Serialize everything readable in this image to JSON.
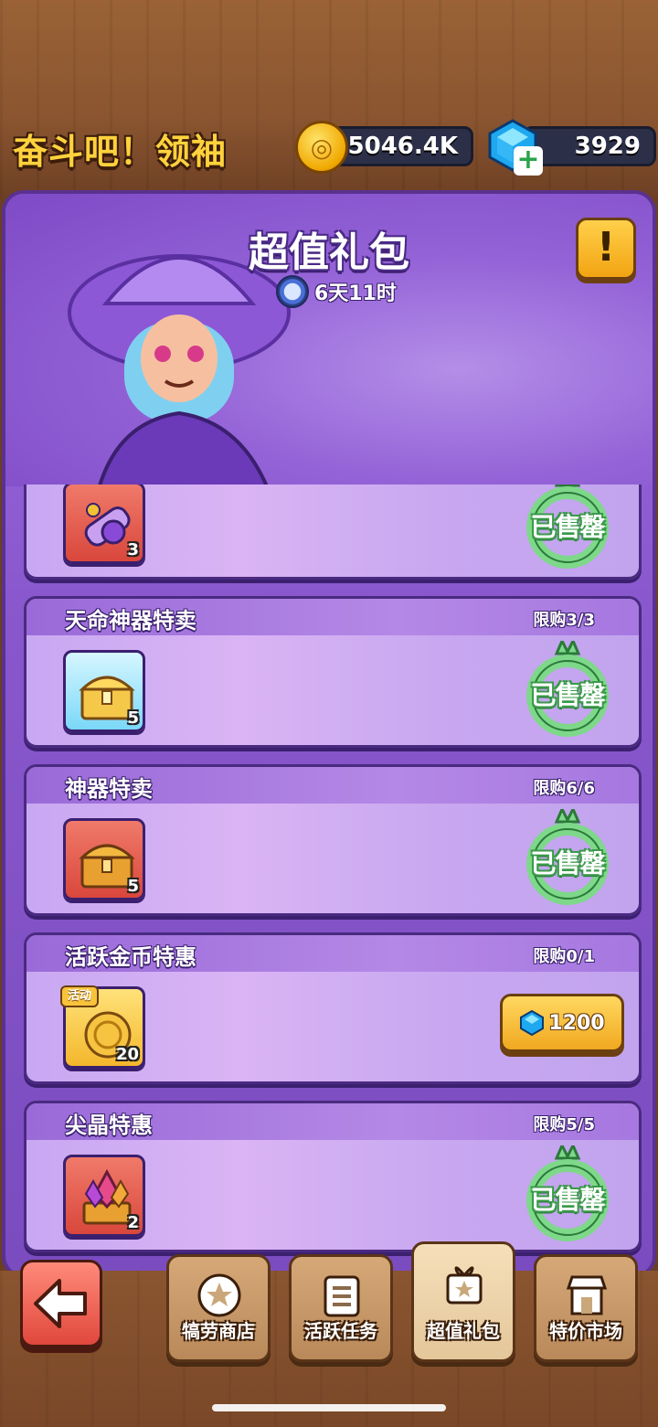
{
  "header": {
    "game_title": "奋斗吧！领袖",
    "coins": "5046.4K",
    "gems": "3929",
    "coin_icon": "coin-icon",
    "gem_icon": "gem-icon",
    "add_gem_icon": "plus-icon"
  },
  "panel": {
    "title": "超值礼包",
    "timer": "6天11时",
    "info_label": "!"
  },
  "packs": [
    {
      "title": "",
      "limit": "",
      "count": "3",
      "item_icon": "scroll-icon",
      "status": "已售罄"
    },
    {
      "title": "天命神器特卖",
      "limit": "限购3/3",
      "count": "5",
      "item_icon": "legendary-chest-icon",
      "status": "已售罄"
    },
    {
      "title": "神器特卖",
      "limit": "限购6/6",
      "count": "5",
      "item_icon": "chest-icon",
      "status": "已售罄"
    },
    {
      "title": "活跃金币特惠",
      "limit": "限购0/1",
      "count": "20",
      "tag": "活动",
      "item_icon": "gold-coin-icon",
      "price": "1200"
    },
    {
      "title": "尖晶特惠",
      "limit": "限购5/5",
      "count": "2",
      "item_icon": "crystal-chest-icon",
      "status": "已售罄"
    }
  ],
  "nav": {
    "tabs": [
      {
        "label": "犒劳商店",
        "icon": "reward-shop-icon"
      },
      {
        "label": "活跃任务",
        "icon": "task-list-icon"
      },
      {
        "label": "超值礼包",
        "icon": "gift-box-icon"
      },
      {
        "label": "特价市场",
        "icon": "market-stall-icon"
      }
    ]
  },
  "colors": {
    "panel_purple": "#8857cc",
    "sold_green": "#3a9a4a",
    "button_gold": "#f0a820",
    "wood": "#8a5530"
  }
}
